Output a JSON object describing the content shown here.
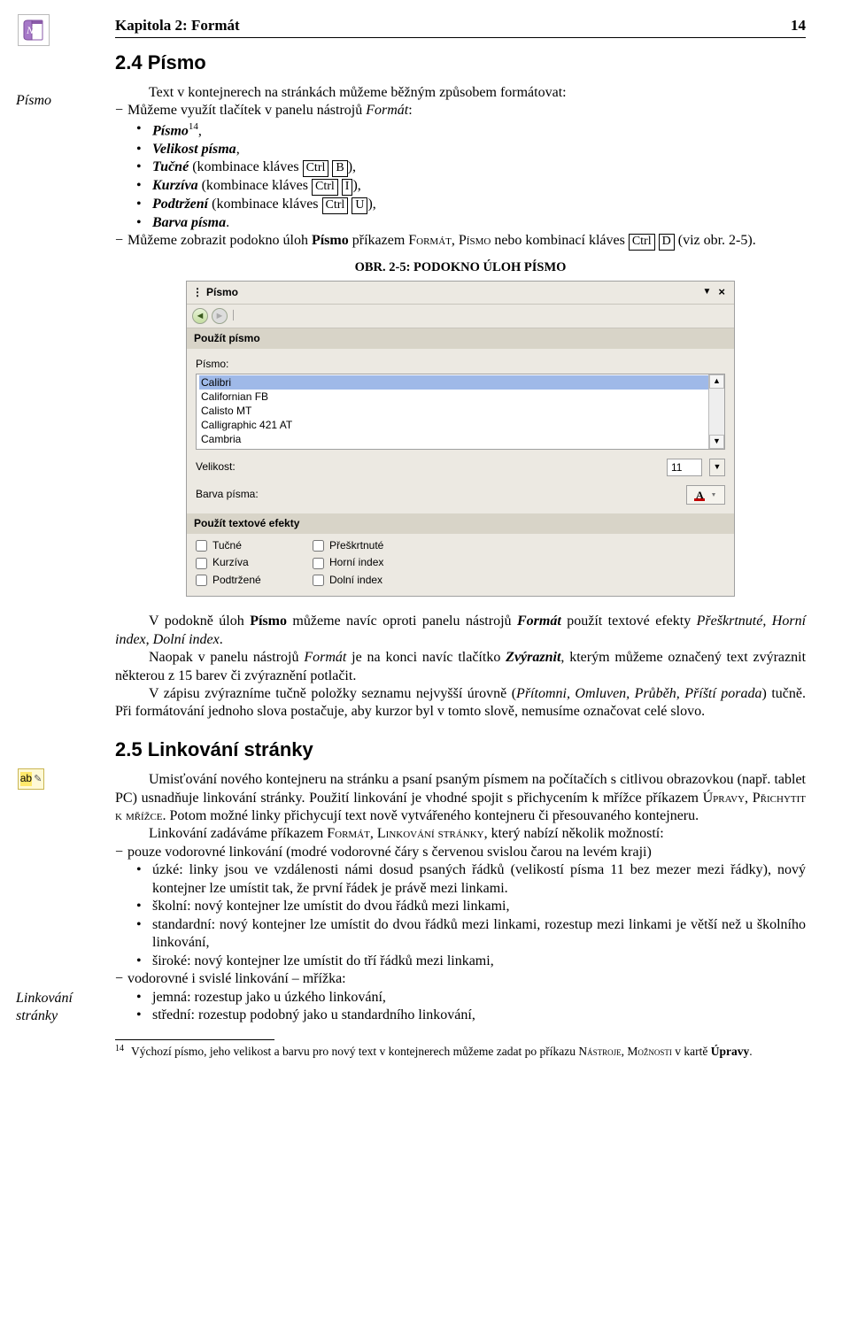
{
  "header": {
    "chapter": "Kapitola 2: Formát",
    "page": "14"
  },
  "margin": {
    "pismo": "Písmo",
    "linkovani": "Linkování stránky"
  },
  "section24": {
    "title": "2.4  Písmo",
    "intro": "Text v kontejnerech na stránkách můžeme běžným způsobem formátovat:",
    "dash1": "Můžeme využít tlačítek v panelu nástrojů ",
    "format": "Formát",
    "b1_a": "Písmo",
    "b1_sup": "14",
    "b1_b": ",",
    "b2": "Velikost písma",
    "b2_b": ",",
    "b3a": "Tučné",
    "b3b": " (kombinace kláves ",
    "b3k1": "Ctrl",
    "b3k2": "B",
    "b3c": "),",
    "b4a": "Kurzíva",
    "b4b": " (kombinace kláves ",
    "b4k1": "Ctrl",
    "b4k2": "I",
    "b4c": "),",
    "b5a": "Podtržení",
    "b5b": " (kombinace kláves ",
    "b5k1": "Ctrl",
    "b5k2": "U",
    "b5c": "),",
    "b6": "Barva písma",
    "b6_b": ".",
    "dash2a": "Můžeme zobrazit podokno úloh ",
    "dash2b": "Písmo",
    "dash2c": " příkazem F",
    "dash2d": "ormát",
    "dash2e": ", P",
    "dash2f": "ísmo",
    "dash2g": " nebo kombinací kláves ",
    "dash2k1": "Ctrl",
    "dash2k2": "D",
    "dash2h": " (viz obr. 2-5)."
  },
  "figure": {
    "caption": "OBR. 2-5: PODOKNO ÚLOH PÍSMO",
    "title": "Písmo",
    "band1": "Použít písmo",
    "l_pismo": "Písmo:",
    "fonts": [
      "Calibri",
      "Californian FB",
      "Calisto MT",
      "Calligraphic 421 AT",
      "Cambria"
    ],
    "l_vel": "Velikost:",
    "size_val": "11",
    "l_barva": "Barva písma:",
    "band2": "Použít textové efekty",
    "fx": {
      "tucne": "Tučné",
      "preskrt": "Přeškrtnuté",
      "kurziva": "Kurzíva",
      "horni": "Horní index",
      "podtrz": "Podtržené",
      "dolni": "Dolní index"
    }
  },
  "after": {
    "p1a": "V podokně úloh ",
    "p1b": "Písmo",
    "p1c": " můžeme navíc oproti panelu nástrojů ",
    "p1d": "Formát",
    "p1e": " použít textové efekty ",
    "p1f": "Přeškrtnuté",
    "p1g": ", ",
    "p1h": "Horní index",
    "p1i": ", ",
    "p1j": "Dolní index",
    "p1k": ".",
    "p2a": "Naopak v panelu nástrojů ",
    "p2b": "Formát",
    "p2c": " je na konci navíc tlačítko ",
    "p2d": "Zvýraznit",
    "p2e": ", kterým můžeme označený text zvýraznit některou z 15 barev či zvýraznění potlačit.",
    "p3a": "V zápisu zvýrazníme tučně položky seznamu nejvyšší úrovně (",
    "p3b": "Přítomni, Omluven, Průběh, Příští porada",
    "p3c": ") tučně. Při formátování jednoho slova postačuje, aby kurzor byl v tomto slově, nemusíme označovat celé slovo."
  },
  "section25": {
    "title": "2.5  Linkování stránky",
    "p1a": "Umisťování nového kontejneru na stránku a psaní psaným písmem na počítačích s citlivou obrazovkou (např. tablet PC) usnadňuje linkování stránky. Použití linkování je vhodné spojit s přichycením k mřížce příkazem Ú",
    "p1b": "pravy",
    "p1c": ", P",
    "p1d": "řichytit k mřížce",
    "p1e": ". Potom možné linky přichycují text nově vytvářeného kontejneru či přesouvaného kontejneru.",
    "p2a": "Linkování zadáváme příkazem F",
    "p2b": "ormát",
    "p2c": ", L",
    "p2d": "inkování stránky",
    "p2e": ", který nabízí několik možností:",
    "d1": "pouze vodorovné linkování (modré vodorovné čáry s červenou svislou čarou na levém kraji)",
    "b1": "úzké: linky jsou ve vzdálenosti námi dosud psaných řádků (velikostí písma 11 bez mezer mezi řádky), nový kontejner lze umístit tak, že první řádek je právě mezi linkami.",
    "b2": "školní: nový kontejner lze umístit do dvou řádků mezi linkami,",
    "b3": "standardní: nový kontejner lze umístit do dvou řádků mezi linkami, rozestup mezi linkami je větší než u školního linkování,",
    "b4": "široké: nový kontejner lze umístit do tří řádků mezi linkami,",
    "d2": "vodorovné i svislé linkování – mřížka:",
    "b5": "jemná: rozestup jako u úzkého linkování,",
    "b6": "střední: rozestup podobný jako u standardního linkování,"
  },
  "footnote": {
    "num": "14",
    "txt_a": "Výchozí písmo, jeho velikost a barvu pro nový text v kontejnerech můžeme zadat po příkazu N",
    "txt_b": "ástroje",
    "txt_c": ", M",
    "txt_d": "ožnosti",
    "txt_e": " v kartě ",
    "txt_f": "Úpravy",
    "txt_g": "."
  }
}
